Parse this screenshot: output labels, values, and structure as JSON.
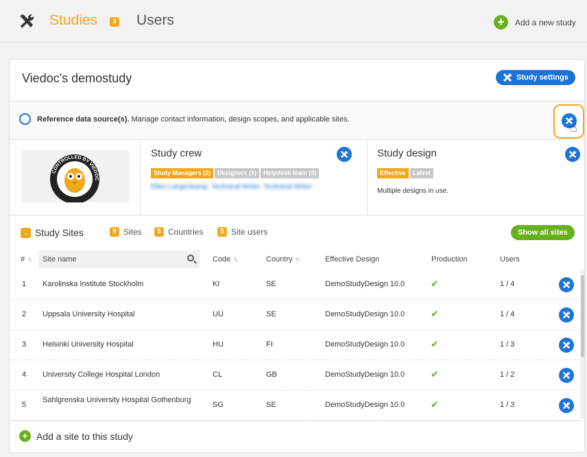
{
  "topbar": {
    "studies_label": "Studies",
    "studies_count": "3",
    "users_label": "Users",
    "add_study_label": "Add a new study"
  },
  "study": {
    "title": "Viedoc's demostudy",
    "settings_label": "Study settings",
    "reference": {
      "bold": "Reference data source(s).",
      "text": " Manage contact information, design scopes, and applicable sites."
    },
    "logo_text": "CONTROLLED BY VIEDOC"
  },
  "crew": {
    "title": "Study crew",
    "chips": [
      "Study Managers (3)",
      "Designers (1)",
      "Helpdesk team (0)"
    ],
    "names": "Ellen Langenkamp, Technical Writer, Technical Writer"
  },
  "design": {
    "title": "Study design",
    "chips": [
      "Effective",
      "Latest"
    ],
    "note": "Multiple designs in use."
  },
  "sites_header": {
    "title": "Study Sites",
    "sites_count": "9",
    "sites_label": "Sites",
    "countries_count": "5",
    "countries_label": "Countries",
    "users_count": "5",
    "users_label": "Site users",
    "show_all_label": "Show all sites"
  },
  "table": {
    "headers": {
      "num": "#",
      "site_name": "Site name",
      "code": "Code",
      "country": "Country",
      "design": "Effective Design",
      "production": "Production",
      "users": "Users"
    },
    "rows": [
      {
        "num": "1",
        "name": "Karolinska Institute Stockholm",
        "code": "KI",
        "country": "SE",
        "design": "DemoStudyDesign 10.0",
        "users": "1 / 4"
      },
      {
        "num": "2",
        "name": "Uppsala University Hospital",
        "code": "UU",
        "country": "SE",
        "design": "DemoStudyDesign 10.0",
        "users": "1 / 4"
      },
      {
        "num": "3",
        "name": "Helsinki University Hospital",
        "code": "HU",
        "country": "FI",
        "design": "DemoStudyDesign 10.0",
        "users": "1 / 3"
      },
      {
        "num": "4",
        "name": "University College Hospital London",
        "code": "CL",
        "country": "GB",
        "design": "DemoStudyDesign 10.0",
        "users": "1 / 2"
      },
      {
        "num": "5",
        "name": "Sahlgrenska University Hospital Gothenburg",
        "code": "SG",
        "country": "SE",
        "design": "DemoStudyDesign 10.0",
        "users": "1 / 3"
      }
    ]
  },
  "footer": {
    "add_site_label": "Add a site to this study"
  },
  "colors": {
    "accent_orange": "#f0a81c",
    "primary_blue": "#1d74d8",
    "success_green": "#67b11d"
  }
}
